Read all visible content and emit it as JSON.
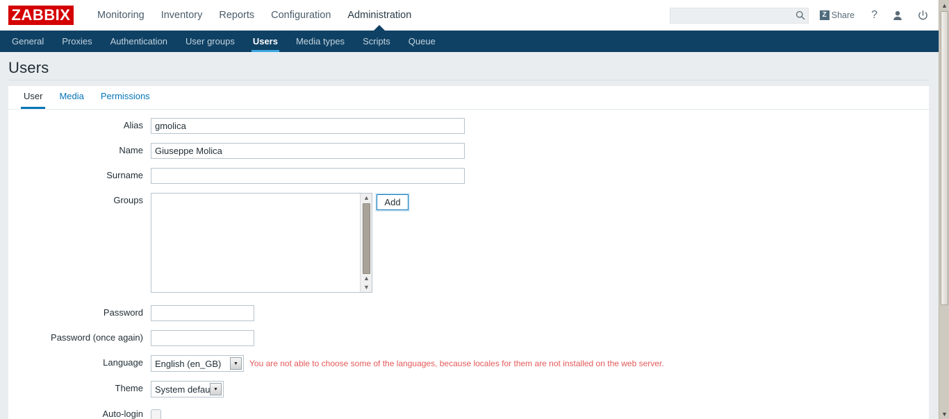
{
  "header": {
    "logo_text": "ZABBIX",
    "logo_bg": "#d40000",
    "menu": [
      {
        "label": "Monitoring",
        "selected": false
      },
      {
        "label": "Inventory",
        "selected": false
      },
      {
        "label": "Reports",
        "selected": false
      },
      {
        "label": "Configuration",
        "selected": false
      },
      {
        "label": "Administration",
        "selected": true
      }
    ],
    "search": {
      "value": "",
      "placeholder": ""
    },
    "share_label": "Share",
    "share_badge": "Z",
    "help_label": "?",
    "icons": [
      "search-icon",
      "user-icon",
      "power-icon"
    ]
  },
  "subnav": {
    "items": [
      {
        "label": "General",
        "selected": false
      },
      {
        "label": "Proxies",
        "selected": false
      },
      {
        "label": "Authentication",
        "selected": false
      },
      {
        "label": "User groups",
        "selected": false
      },
      {
        "label": "Users",
        "selected": true
      },
      {
        "label": "Media types",
        "selected": false
      },
      {
        "label": "Scripts",
        "selected": false
      },
      {
        "label": "Queue",
        "selected": false
      }
    ],
    "bg": "#0f4164",
    "accent": "#3ba7e0"
  },
  "page": {
    "title": "Users"
  },
  "tabs": [
    {
      "label": "User",
      "active": true
    },
    {
      "label": "Media",
      "active": false
    },
    {
      "label": "Permissions",
      "active": false
    }
  ],
  "form": {
    "alias": {
      "label": "Alias",
      "value": "gmolica"
    },
    "name": {
      "label": "Name",
      "value": "Giuseppe Molica"
    },
    "surname": {
      "label": "Surname",
      "value": ""
    },
    "groups": {
      "label": "Groups",
      "items": [],
      "add_button": "Add"
    },
    "password": {
      "label": "Password",
      "value": ""
    },
    "password_again": {
      "label": "Password (once again)",
      "value": ""
    },
    "language": {
      "label": "Language",
      "value": "English (en_GB)"
    },
    "language_warning": "You are not able to choose some of the languages, because locales for them are not installed on the web server.",
    "theme": {
      "label": "Theme",
      "value": "System default"
    },
    "autologin": {
      "label": "Auto-login",
      "checked": false
    }
  },
  "colors": {
    "warning": "#e45959",
    "link": "#0275b8",
    "page_bg": "#e9edf0"
  }
}
